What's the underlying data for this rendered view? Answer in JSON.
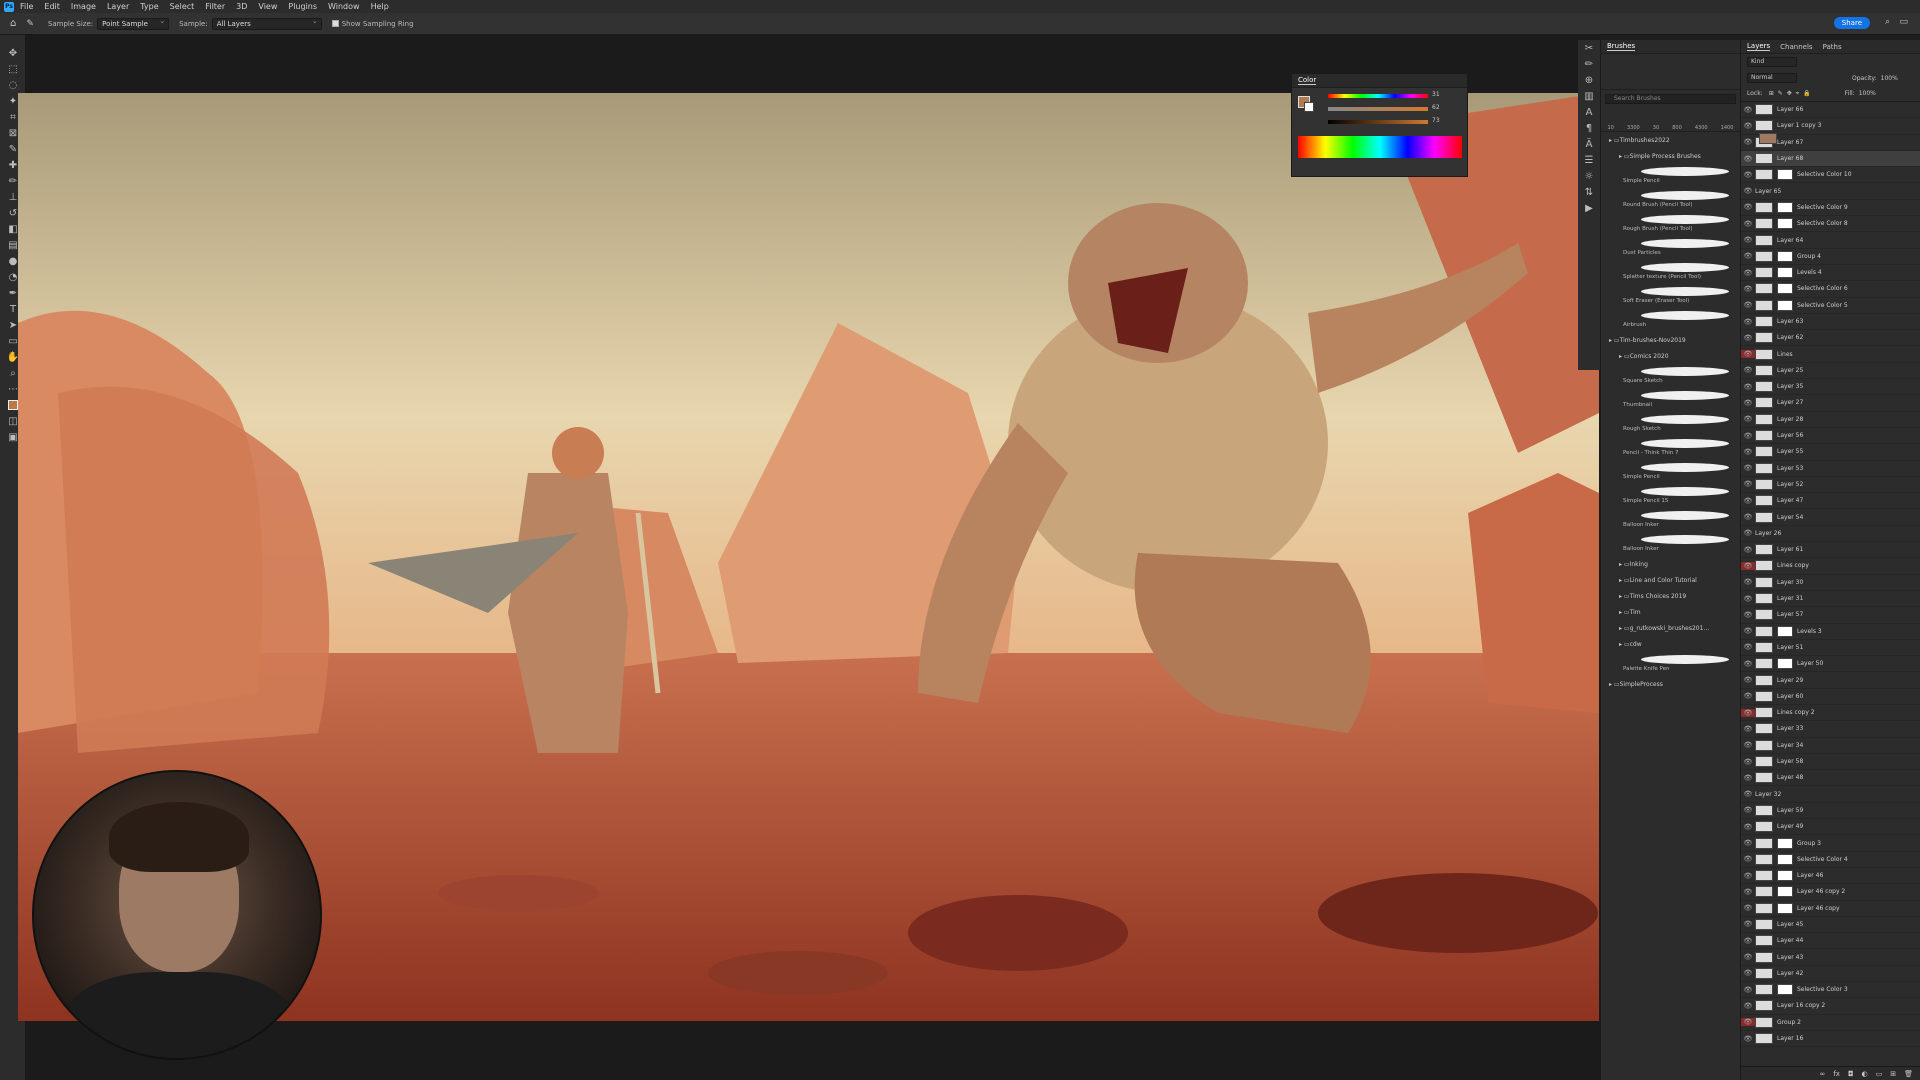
{
  "app": {
    "logo": "Ps"
  },
  "menu": [
    "File",
    "Edit",
    "Image",
    "Layer",
    "Type",
    "Select",
    "Filter",
    "3D",
    "View",
    "Plugins",
    "Window",
    "Help"
  ],
  "options": {
    "sample_size_label": "Sample Size:",
    "sample_size_value": "Point Sample",
    "sample_label": "Sample:",
    "sample_value": "All Layers",
    "sampling_ring": "Show Sampling Ring",
    "share": "Share"
  },
  "color_panel": {
    "title": "Color",
    "values": [
      "31",
      "62",
      "73"
    ]
  },
  "brushes": {
    "title": "Brushes",
    "search": "Search Brushes",
    "sizes": [
      "10",
      "3300",
      "30",
      "800",
      "4300",
      "1400"
    ],
    "groups": [
      {
        "type": "folder",
        "label": "Timbrushes2022"
      },
      {
        "type": "folder",
        "label": "Simple Process Brushes",
        "indent": 1
      },
      {
        "type": "brush",
        "label": "Simple Pencil"
      },
      {
        "type": "brush",
        "label": "Round Brush (Pencil Tool)"
      },
      {
        "type": "brush",
        "label": "Rough Brush (Pencil Tool)"
      },
      {
        "type": "brush",
        "label": "Dust Particles"
      },
      {
        "type": "brush",
        "label": "Splatter texture (Pencil Tool)"
      },
      {
        "type": "brush",
        "label": "Soft Eraser (Eraser Tool)"
      },
      {
        "type": "brush",
        "label": "Airbrush"
      },
      {
        "type": "folder",
        "label": "Tim-brushes-Nov2019"
      },
      {
        "type": "folder",
        "label": "Comics 2020",
        "indent": 1
      },
      {
        "type": "brush",
        "label": "Square Sketch"
      },
      {
        "type": "brush",
        "label": "Thumbnail"
      },
      {
        "type": "brush",
        "label": "Rough Sketch"
      },
      {
        "type": "brush",
        "label": "Pencil - Think Thin 7"
      },
      {
        "type": "brush",
        "label": "Simple Pencil"
      },
      {
        "type": "brush",
        "label": "Simple Pencil 15"
      },
      {
        "type": "brush",
        "label": "Balloon Inker"
      },
      {
        "type": "brush",
        "label": "Balloon Inker"
      },
      {
        "type": "folder",
        "label": "Inking",
        "indent": 1
      },
      {
        "type": "folder",
        "label": "Line and Color Tutorial",
        "indent": 1
      },
      {
        "type": "folder",
        "label": "Tims Choices 2019",
        "indent": 1
      },
      {
        "type": "folder",
        "label": "Tim",
        "indent": 1
      },
      {
        "type": "folder",
        "label": "g_rutkowski_brushes201...",
        "indent": 1
      },
      {
        "type": "folder",
        "label": "cdw",
        "indent": 1
      },
      {
        "type": "brush",
        "label": "Palette Knife Pen"
      },
      {
        "type": "folder",
        "label": "SimpleProcess"
      }
    ]
  },
  "layers_panel": {
    "tabs": [
      "Layers",
      "Channels",
      "Paths"
    ],
    "kind": "Kind",
    "blend": "Normal",
    "opacity_label": "Opacity:",
    "opacity": "100%",
    "lock_label": "Lock:",
    "fill_label": "Fill:",
    "fill": "100%",
    "layers": [
      {
        "name": "Layer 66"
      },
      {
        "name": "Layer 1 copy 3"
      },
      {
        "name": "Layer 67"
      },
      {
        "name": "Layer 68",
        "selected": true
      },
      {
        "name": "Selective Color 10",
        "adj": true
      },
      {
        "name": "Layer 65",
        "art": true
      },
      {
        "name": "Selective Color 9",
        "adj": true
      },
      {
        "name": "Selective Color 8",
        "adj": true
      },
      {
        "name": "Layer 64"
      },
      {
        "name": "Group 4",
        "adj": true
      },
      {
        "name": "Levels 4",
        "adj": true
      },
      {
        "name": "Selective Color 6",
        "adj": true
      },
      {
        "name": "Selective Color 5",
        "adj": true
      },
      {
        "name": "Layer 63"
      },
      {
        "name": "Layer 62"
      },
      {
        "name": "Lines",
        "red": true
      },
      {
        "name": "Layer 25"
      },
      {
        "name": "Layer 35"
      },
      {
        "name": "Layer 27"
      },
      {
        "name": "Layer 28"
      },
      {
        "name": "Layer 56"
      },
      {
        "name": "Layer 55"
      },
      {
        "name": "Layer 53"
      },
      {
        "name": "Layer 52"
      },
      {
        "name": "Layer 47"
      },
      {
        "name": "Layer 54"
      },
      {
        "name": "Layer 26",
        "art": true
      },
      {
        "name": "Layer 61"
      },
      {
        "name": "Lines copy",
        "red": true
      },
      {
        "name": "Layer 30"
      },
      {
        "name": "Layer 31"
      },
      {
        "name": "Layer 57"
      },
      {
        "name": "Levels 3",
        "adj": true
      },
      {
        "name": "Layer 51"
      },
      {
        "name": "Layer 50",
        "adj": true
      },
      {
        "name": "Layer 29"
      },
      {
        "name": "Layer 60"
      },
      {
        "name": "Lines copy 2",
        "red": true
      },
      {
        "name": "Layer 33"
      },
      {
        "name": "Layer 34"
      },
      {
        "name": "Layer 58"
      },
      {
        "name": "Layer 48"
      },
      {
        "name": "Layer 32",
        "art": true
      },
      {
        "name": "Layer 59"
      },
      {
        "name": "Layer 49"
      },
      {
        "name": "Group 3",
        "adj": true
      },
      {
        "name": "Selective Color 4",
        "adj": true
      },
      {
        "name": "Layer 46",
        "adj": true
      },
      {
        "name": "Layer 46 copy 2",
        "adj": true
      },
      {
        "name": "Layer 46 copy",
        "adj": true
      },
      {
        "name": "Layer 45"
      },
      {
        "name": "Layer 44"
      },
      {
        "name": "Layer 43"
      },
      {
        "name": "Layer 42"
      },
      {
        "name": "Selective Color 3",
        "adj": true
      },
      {
        "name": "Layer 16 copy 2"
      },
      {
        "name": "Group 2",
        "red": true
      },
      {
        "name": "Layer 16"
      }
    ]
  }
}
